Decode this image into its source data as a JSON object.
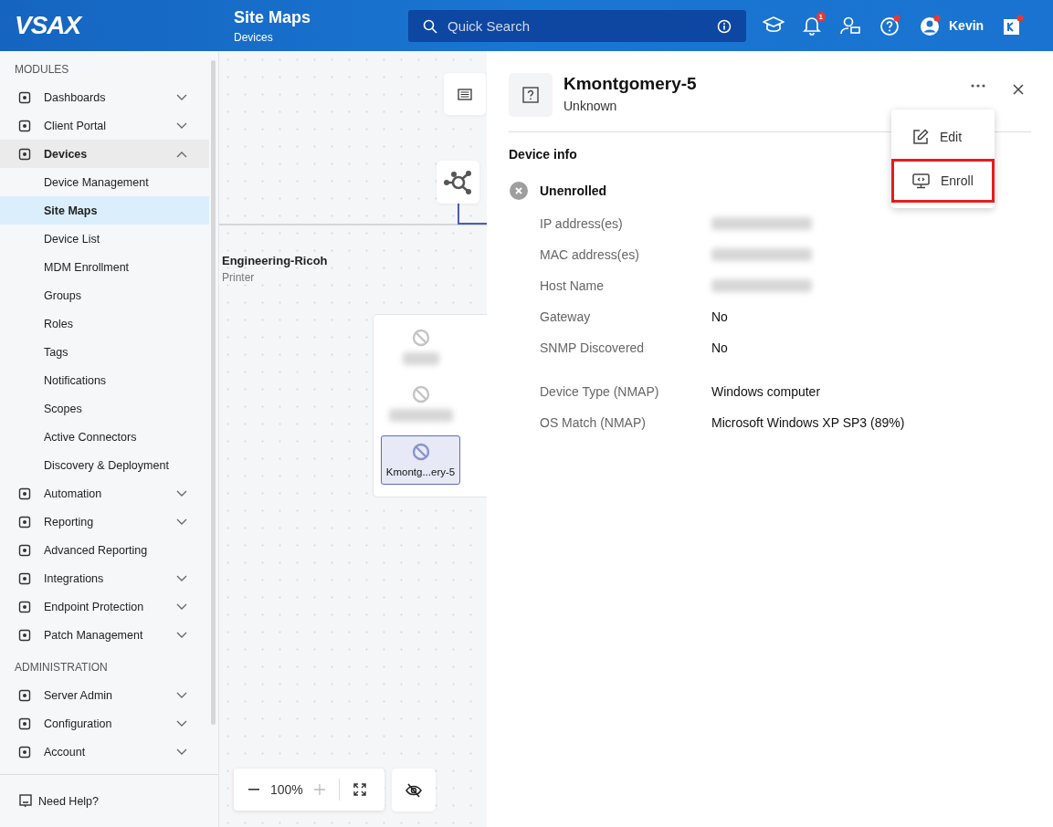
{
  "header": {
    "logo": "VSAX",
    "title": "Site Maps",
    "subtitle": "Devices",
    "search": {
      "placeholder": "Quick Search"
    },
    "notification_count": "1",
    "user": "Kevin"
  },
  "sidebar": {
    "sections": [
      {
        "heading": "MODULES",
        "items": [
          {
            "label": "Dashboards",
            "kind": "group",
            "expanded": false,
            "selected": false
          },
          {
            "label": "Client Portal",
            "kind": "group",
            "expanded": false,
            "selected": false
          },
          {
            "label": "Devices",
            "kind": "group",
            "expanded": true,
            "selected": false,
            "children": [
              {
                "label": "Device Management",
                "selected": false
              },
              {
                "label": "Site Maps",
                "selected": true
              },
              {
                "label": "Device List",
                "selected": false
              },
              {
                "label": "MDM Enrollment",
                "selected": false
              },
              {
                "label": "Groups",
                "selected": false
              },
              {
                "label": "Roles",
                "selected": false
              },
              {
                "label": "Tags",
                "selected": false
              },
              {
                "label": "Notifications",
                "selected": false
              },
              {
                "label": "Scopes",
                "selected": false
              },
              {
                "label": "Active Connectors",
                "selected": false
              },
              {
                "label": "Discovery & Deployment",
                "selected": false
              }
            ]
          },
          {
            "label": "Automation",
            "kind": "group",
            "expanded": false,
            "selected": false
          },
          {
            "label": "Reporting",
            "kind": "group",
            "expanded": false,
            "selected": false
          },
          {
            "label": "Advanced Reporting",
            "kind": "link",
            "expanded": false,
            "selected": false
          },
          {
            "label": "Integrations",
            "kind": "group",
            "expanded": false,
            "selected": false
          },
          {
            "label": "Endpoint Protection",
            "kind": "group",
            "expanded": false,
            "selected": false
          },
          {
            "label": "Patch Management",
            "kind": "group",
            "expanded": false,
            "selected": false
          }
        ]
      },
      {
        "heading": "ADMINISTRATION",
        "items": [
          {
            "label": "Server Admin",
            "kind": "group",
            "expanded": false,
            "selected": false
          },
          {
            "label": "Configuration",
            "kind": "group",
            "expanded": false,
            "selected": false
          },
          {
            "label": "Account",
            "kind": "group",
            "expanded": false,
            "selected": false
          }
        ]
      }
    ],
    "footer": "Need Help?"
  },
  "map": {
    "group": {
      "name": "Engineering-Ricoh",
      "type": "Printer"
    },
    "nodes": [
      {
        "kind": "redacted",
        "selected": false
      },
      {
        "kind": "redacted",
        "selected": false
      },
      {
        "kind": "device",
        "label": "Kmontg...ery-5",
        "selected": true
      }
    ],
    "zoom": "100%"
  },
  "panel": {
    "title": "Kmontgomery-5",
    "subtitle": "Unknown",
    "section": "Device info",
    "status": "Unenrolled",
    "enrolled": false,
    "field_groups": [
      [
        {
          "label": "IP address(es)",
          "kind": "redacted"
        },
        {
          "label": "MAC address(es)",
          "kind": "redacted"
        },
        {
          "label": "Host Name",
          "kind": "redacted"
        },
        {
          "label": "Gateway",
          "kind": "text",
          "value": "No"
        },
        {
          "label": "SNMP Discovered",
          "kind": "text",
          "value": "No"
        }
      ],
      [
        {
          "label": "Device Type (NMAP)",
          "kind": "text",
          "value": "Windows computer"
        },
        {
          "label": "OS Match (NMAP)",
          "kind": "text",
          "value": "Microsoft Windows XP SP3 (89%)"
        }
      ]
    ],
    "menu": [
      {
        "label": "Edit",
        "highlighted": false
      },
      {
        "label": "Enroll",
        "highlighted": true
      }
    ]
  }
}
